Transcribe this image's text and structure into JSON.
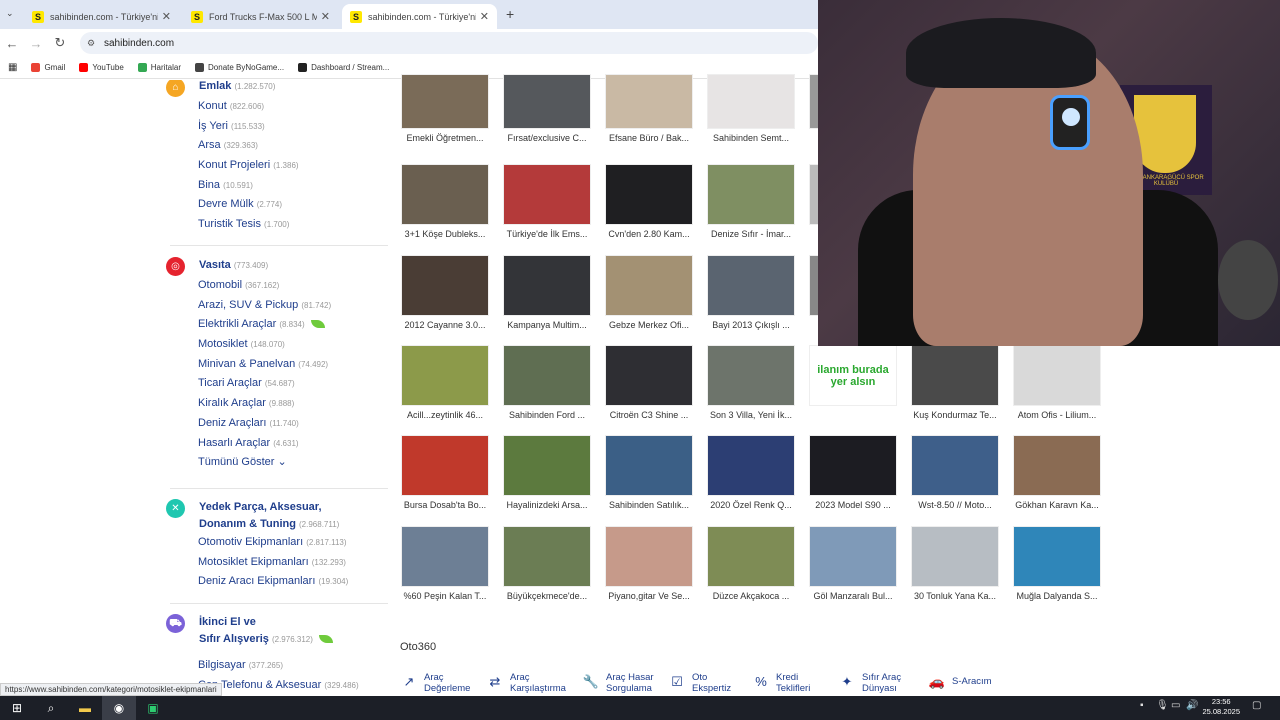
{
  "tabs": [
    {
      "favicon": "S",
      "title": "sahibinden.com - Türkiye'nin Ö",
      "active": false
    },
    {
      "favicon": "S",
      "title": "Ford Trucks F-Max 500 L Model",
      "active": false
    },
    {
      "favicon": "S",
      "title": "sahibinden.com - Türkiye'nin Ö",
      "active": true
    }
  ],
  "new_tab": "+",
  "address": {
    "url": "sahibinden.com"
  },
  "bookmarks": [
    {
      "label": "Gmail",
      "color": "#ea4335"
    },
    {
      "label": "YouTube",
      "color": "#ff0000"
    },
    {
      "label": "Haritalar",
      "color": "#34a853"
    },
    {
      "label": "Donate ByNoGame...",
      "color": "#444444"
    },
    {
      "label": "Dashboard / Stream...",
      "color": "#222222"
    }
  ],
  "sidebar": {
    "emlak": {
      "title": "Emlak",
      "count": "(1.282.570)",
      "color": "#f5a623",
      "items": [
        {
          "label": "Konut",
          "count": "(822.606)"
        },
        {
          "label": "İş Yeri",
          "count": "(115.533)"
        },
        {
          "label": "Arsa",
          "count": "(329.363)"
        },
        {
          "label": "Konut Projeleri",
          "count": "(1.386)"
        },
        {
          "label": "Bina",
          "count": "(10.591)"
        },
        {
          "label": "Devre Mülk",
          "count": "(2.774)"
        },
        {
          "label": "Turistik Tesis",
          "count": "(1.700)"
        }
      ]
    },
    "vasita": {
      "title": "Vasıta",
      "count": "(773.409)",
      "color": "#e5232e",
      "items": [
        {
          "label": "Otomobil",
          "count": "(367.162)"
        },
        {
          "label": "Arazi, SUV & Pickup",
          "count": "(81.742)"
        },
        {
          "label": "Elektrikli Araçlar",
          "count": "(8.834)",
          "leaf": true
        },
        {
          "label": "Motosiklet",
          "count": "(148.070)"
        },
        {
          "label": "Minivan & Panelvan",
          "count": "(74.492)"
        },
        {
          "label": "Ticari Araçlar",
          "count": "(54.687)"
        },
        {
          "label": "Kiralık Araçlar",
          "count": "(9.888)"
        },
        {
          "label": "Deniz Araçları",
          "count": "(11.740)"
        },
        {
          "label": "Hasarlı Araçlar",
          "count": "(4.631)"
        }
      ],
      "show_all": "Tümünü Göster"
    },
    "yedek": {
      "title_line1": "Yedek Parça, Aksesuar,",
      "title_line2": "Donanım & Tuning",
      "count": "(2.968.711)",
      "color": "#1fc7b0",
      "items": [
        {
          "label": "Otomotiv Ekipmanları",
          "count": "(2.817.113)"
        },
        {
          "label": "Motosiklet Ekipmanları",
          "count": "(132.293)"
        },
        {
          "label": "Deniz Aracı Ekipmanları",
          "count": "(19.304)"
        }
      ]
    },
    "ikinciel": {
      "title_line1": "İkinci El ve",
      "title_line2": "Sıfır Alışveriş",
      "count": "(2.976.312)",
      "color": "#7b62d8",
      "items": [
        {
          "label": "Bilgisayar",
          "count": "(377.265)"
        },
        {
          "label": "Cep Telefonu & Aksesuar",
          "count": "(329.486)"
        }
      ]
    }
  },
  "grid": [
    [
      {
        "cap": "Emekli Öğretmen...",
        "color": "#7a6b58"
      },
      {
        "cap": "Fırsat/exclusive C...",
        "color": "#55585c"
      },
      {
        "cap": "Efsane Büro / Bak...",
        "color": "#c9b9a4"
      },
      {
        "cap": "Sahibinden Semt...",
        "color": "#e7e4e4"
      },
      {
        "cap": "Sa",
        "color": "#999999"
      }
    ],
    [
      {
        "cap": "3+1 Köşe Dubleks...",
        "color": "#6a5f50"
      },
      {
        "cap": "Türkiye'de İlk Ems...",
        "color": "#b43a3a"
      },
      {
        "cap": "Cvn'den 2.80 Kam...",
        "color": "#1f1f22"
      },
      {
        "cap": "Denize Sıfır - İmar...",
        "color": "#7f8f62"
      },
      {
        "cap": "Ni",
        "color": "#bbbbbb"
      }
    ],
    [
      {
        "cap": "2012 Cayanne 3.0...",
        "color": "#4a3d35"
      },
      {
        "cap": "Kampanya Multim...",
        "color": "#333438"
      },
      {
        "cap": "Gebze Merkez Ofi...",
        "color": "#a39173"
      },
      {
        "cap": "Bayi 2013 Çıkışlı ...",
        "color": "#5a6470"
      },
      {
        "cap": "Ac",
        "color": "#888888"
      }
    ],
    [
      {
        "cap": "Acill...zeytinlik 46...",
        "color": "#8c9a4a"
      },
      {
        "cap": "Sahibinden Ford ...",
        "color": "#5f6e52"
      },
      {
        "cap": "Citroën C3 Shine ...",
        "color": "#2e2e33"
      },
      {
        "cap": "Son 3 Villa, Yeni İk...",
        "color": "#6d746b"
      },
      {
        "cap": "ilanım burada yer alsın",
        "color": "#2aa82f"
      },
      {
        "cap": "Kuş Kondurmaz Te...",
        "color": "#4a4a4a"
      },
      {
        "cap": "Atom Ofis - Lilium...",
        "color": "#d9d9d9"
      }
    ],
    [
      {
        "cap": "Bursa Dosab'ta Bo...",
        "color": "#c0392b"
      },
      {
        "cap": "Hayalinizdeki Arsa...",
        "color": "#5c7a3e"
      },
      {
        "cap": "Sahibinden Satılık...",
        "color": "#3b5f86"
      },
      {
        "cap": "2020 Özel Renk Q...",
        "color": "#2c3e73"
      },
      {
        "cap": "2023 Model S90 ...",
        "color": "#1c1c22"
      },
      {
        "cap": "Wst-8.50 // Moto...",
        "color": "#3e5f8a"
      },
      {
        "cap": "Gökhan Karavn Ka...",
        "color": "#8a6b53"
      }
    ],
    [
      {
        "cap": "%60 Peşin Kalan T...",
        "color": "#6d7f95"
      },
      {
        "cap": "Büyükçekmece'de...",
        "color": "#6b7d54"
      },
      {
        "cap": "Piyano,gitar Ve Se...",
        "color": "#c69a8a"
      },
      {
        "cap": "Düzce Akçakoca ...",
        "color": "#7e8c55"
      },
      {
        "cap": "Göl Manzaralı Bul...",
        "color": "#7f9ab8"
      },
      {
        "cap": "30 Tonluk Yana Ka...",
        "color": "#b7bdc3"
      },
      {
        "cap": "Muğla Dalyanda S...",
        "color": "#2f86b9"
      }
    ]
  ],
  "oto360": {
    "title": "Oto360",
    "items": [
      {
        "line1": "Araç",
        "line2": "Değerleme",
        "icon": "↗"
      },
      {
        "line1": "Araç",
        "line2": "Karşılaştırma",
        "icon": "⇄"
      },
      {
        "line1": "Araç Hasar",
        "line2": "Sorgulama",
        "icon": "🔧"
      },
      {
        "line1": "Oto",
        "line2": "Ekspertiz",
        "icon": "☑"
      },
      {
        "line1": "Kredi",
        "line2": "Teklifleri",
        "icon": "%"
      },
      {
        "line1": "Sıfır Araç",
        "line2": "Dünyası",
        "icon": "✦"
      },
      {
        "line1": "S-Aracım",
        "line2": "",
        "icon": "🚗"
      }
    ]
  },
  "status_url": "https://www.sahibinden.com/kategori/motosiklet-ekipmanlari",
  "webcam": {
    "flag_text": "MKE ANKARAGÜCÜ SPOR KULÜBÜ"
  },
  "taskbar": {
    "time": "23:56",
    "date": "25.08.2025"
  }
}
